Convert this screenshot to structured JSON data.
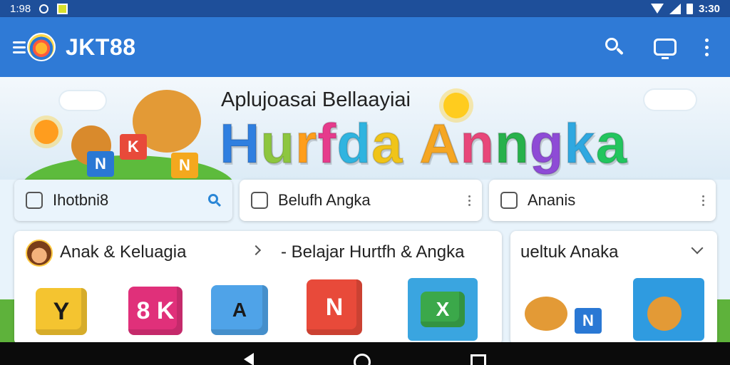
{
  "status_bar": {
    "left_time": "1:98",
    "right_time": "3:30",
    "icons": [
      "circle-notification-icon",
      "square-app-icon",
      "wifi-icon",
      "signal-icon",
      "battery-icon"
    ]
  },
  "app_bar": {
    "title": "JKT88",
    "icons": [
      "menu-icon",
      "logo",
      "search-icon",
      "tv-icon",
      "more-vert-icon"
    ]
  },
  "hero": {
    "subtitle": "Aplujoasai Bellaayiai",
    "title_letters": [
      {
        "char": "H",
        "color": "#2f7fe0"
      },
      {
        "char": "u",
        "color": "#8dc63f"
      },
      {
        "char": "r",
        "color": "#ff9e1b"
      },
      {
        "char": "f",
        "color": "#e63b8c"
      },
      {
        "char": "d",
        "color": "#2fb4e0"
      },
      {
        "char": "a",
        "color": "#f0c419"
      },
      {
        "char": " ",
        "color": "#ffffff"
      },
      {
        "char": "A",
        "color": "#f5a623"
      },
      {
        "char": "n",
        "color": "#e8477a"
      },
      {
        "char": "n",
        "color": "#27b14b"
      },
      {
        "char": "g",
        "color": "#8e4bd6"
      },
      {
        "char": "k",
        "color": "#2fa8e0"
      },
      {
        "char": "a",
        "color": "#22c55e"
      }
    ],
    "blocks": [
      "N",
      "K",
      "N"
    ]
  },
  "quick_cards": [
    {
      "label": "Ihotbni8",
      "icon": "app-icon",
      "action": "search-icon"
    },
    {
      "label": "Belufh Angka",
      "icon": "book-icon",
      "action": "more-icon"
    },
    {
      "label": "Ananis",
      "icon": "share-icon",
      "action": "more-icon"
    }
  ],
  "panels": [
    {
      "title": "Anak & Keluagia",
      "subtitle": "- Belajar Hurtfh & Angka",
      "cubes": [
        {
          "text": "Y",
          "color": "#f4c430"
        },
        {
          "text": "8 K",
          "color": "#e0307a"
        },
        {
          "text": "A",
          "color": "#4fa3e8"
        },
        {
          "text": "N",
          "color": "#e84a3a"
        },
        {
          "text": "X",
          "color": "#3ba84a"
        }
      ]
    },
    {
      "title": "ueltuk Anaka",
      "thumb_letters": [
        "N"
      ]
    }
  ]
}
